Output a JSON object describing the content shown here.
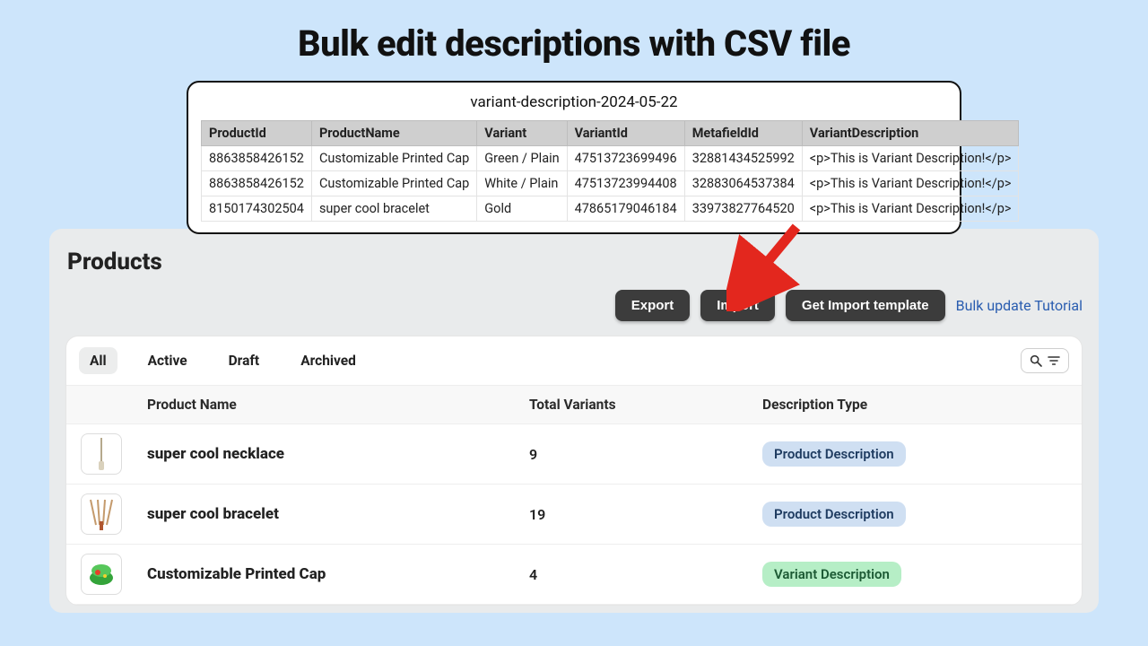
{
  "title": "Bulk edit descriptions with CSV file",
  "csv": {
    "filename": "variant-description-2024-05-22",
    "headers": [
      "ProductId",
      "ProductName",
      "Variant",
      "VariantId",
      "MetafieldId",
      "VariantDescription"
    ],
    "rows": [
      {
        "c0": "8863858426152",
        "c1": "Customizable Printed Cap",
        "c2": "Green / Plain",
        "c3": "47513723699496",
        "c4": "32881434525992",
        "c5": "<p>This is Variant Description!</p>"
      },
      {
        "c0": "8863858426152",
        "c1": "Customizable Printed Cap",
        "c2": "White / Plain",
        "c3": "47513723994408",
        "c4": "32883064537384",
        "c5": "<p>This is Variant Description!</p>"
      },
      {
        "c0": "8150174302504",
        "c1": "super cool bracelet",
        "c2": "Gold",
        "c3": "47865179046184",
        "c4": "33973827764520",
        "c5": "<p>This is Variant Description!</p>"
      }
    ]
  },
  "panel": {
    "heading": "Products",
    "buttons": {
      "export": "Export",
      "import": "Import",
      "template": "Get Import template"
    },
    "link": "Bulk update Tutorial",
    "tabs": {
      "all": "All",
      "active": "Active",
      "draft": "Draft",
      "archived": "Archived"
    },
    "columns": {
      "name": "Product Name",
      "variants": "Total Variants",
      "desc": "Description Type"
    },
    "rows": [
      {
        "name": "super cool necklace",
        "variants": "9",
        "badge": "Product Description",
        "badgeClass": "badge-blue",
        "thumb": "necklace"
      },
      {
        "name": "super cool bracelet",
        "variants": "19",
        "badge": "Product Description",
        "badgeClass": "badge-blue",
        "thumb": "bracelet"
      },
      {
        "name": "Customizable Printed Cap",
        "variants": "4",
        "badge": "Variant Description",
        "badgeClass": "badge-green",
        "thumb": "cap"
      }
    ]
  }
}
